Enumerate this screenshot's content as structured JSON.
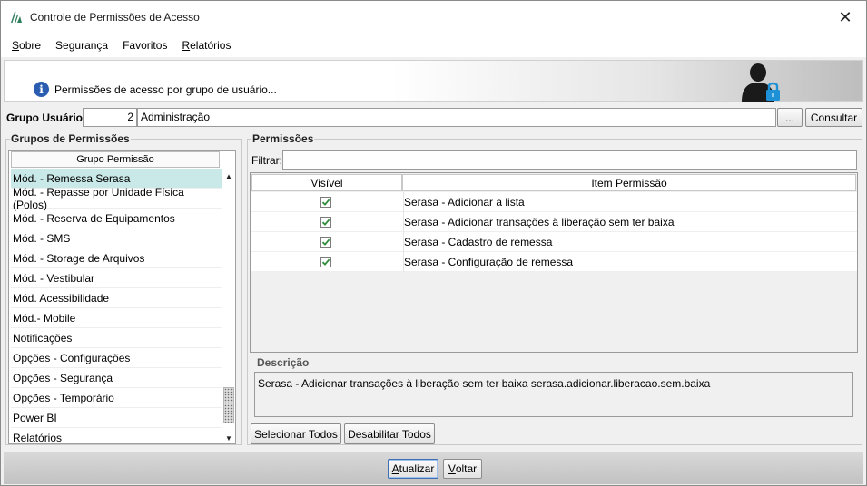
{
  "window": {
    "title": "Controle de Permissões de Acesso",
    "close_symbol": "✕"
  },
  "menu": [
    {
      "first": "S",
      "rest": "obre"
    },
    {
      "first": "",
      "rest": "Segurança"
    },
    {
      "first": "",
      "rest": "Favoritos"
    },
    {
      "first": "R",
      "rest": "elatórios"
    }
  ],
  "banner": {
    "text": "Permissões de acesso por grupo de usuário...",
    "info_icon": "info-icon",
    "image_icon": "user-lock-icon"
  },
  "group_user": {
    "label": "Grupo Usuário:",
    "id": "2",
    "name": "Administração",
    "ellipsis_label": "...",
    "consultar_label": "Consultar"
  },
  "permission_groups": {
    "legend": "Grupos de Permissões",
    "header": "Grupo Permissão",
    "selected_index": 0,
    "items": [
      "Mód. - Remessa Serasa",
      "Mód. - Repasse por Unidade Física (Polos)",
      "Mód. - Reserva de Equipamentos",
      "Mód. - SMS",
      "Mód. - Storage de Arquivos",
      "Mód. - Vestibular",
      "Mód. Acessibilidade",
      "Mód.- Mobile",
      "Notificações",
      "Opções - Configurações",
      "Opções - Segurança",
      "Opções - Temporário",
      "Power BI",
      "Relatórios"
    ]
  },
  "permissions": {
    "legend": "Permissões",
    "filter_label": "Filtrar:",
    "filter_value": "",
    "columns": [
      "Visível",
      "Item Permissão"
    ],
    "rows": [
      {
        "visible": true,
        "item": "Serasa - Adicionar a lista"
      },
      {
        "visible": true,
        "item": "Serasa - Adicionar transações à liberação sem ter baixa"
      },
      {
        "visible": true,
        "item": "Serasa - Cadastro de remessa"
      },
      {
        "visible": true,
        "item": "Serasa - Configuração de remessa"
      }
    ]
  },
  "description": {
    "legend": "Descrição",
    "text": "Serasa - Adicionar transações à liberação sem ter baixa serasa.adicionar.liberacao.sem.baixa"
  },
  "actions": {
    "select_all": "Selecionar Todos",
    "disable_all": "Desabilitar Todos"
  },
  "footer": {
    "atualizar_first": "A",
    "atualizar_rest": "tualizar",
    "voltar_first": "V",
    "voltar_rest": "oltar"
  },
  "colors": {
    "selected_row": "#c9e9e8",
    "check": "#2e8b3a",
    "info_blue": "#2a5db0",
    "lock_blue": "#1e90d6"
  }
}
